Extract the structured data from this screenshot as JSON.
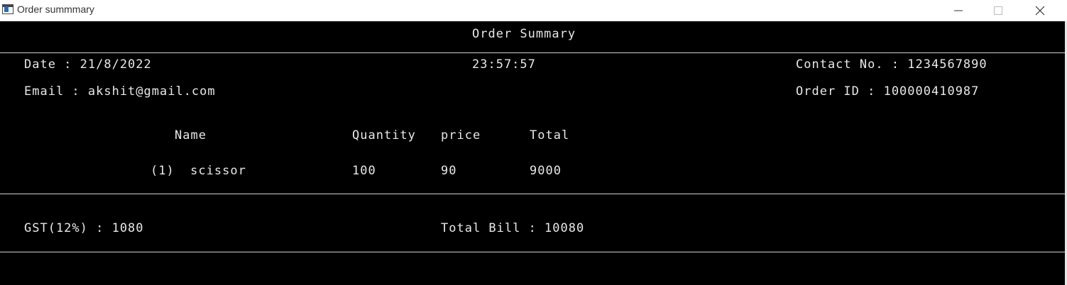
{
  "window": {
    "title": "Order summmary"
  },
  "report": {
    "heading": "Order Summary",
    "date": "Date : 21/8/2022",
    "time": "23:57:57",
    "contact": "Contact No. : 1234567890",
    "email": "Email : akshit@gmail.com",
    "order_id": "Order ID : 100000410987",
    "columns": [
      "Name",
      "Quantity",
      "price",
      "Total"
    ],
    "items": [
      {
        "name": "(1)  scissor",
        "quantity": "100",
        "price": "90",
        "total": "9000"
      }
    ],
    "gst": "GST(12%) : 1080",
    "total_bill": "Total Bill : 10080"
  },
  "colors": {
    "background": "#000000",
    "text": "#e8e8e8",
    "divider": "#d0d0d0"
  }
}
